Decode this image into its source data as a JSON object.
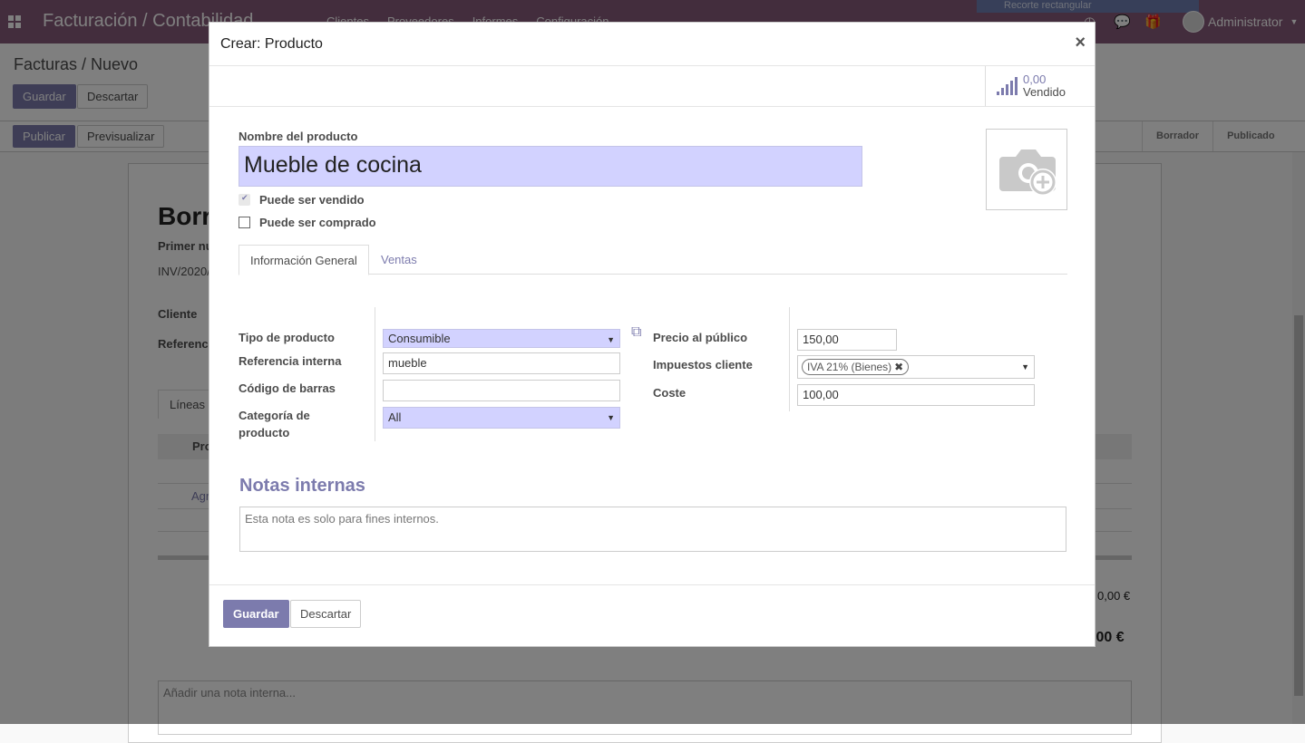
{
  "topbar": {
    "app_title": "Facturación / Contabilidad",
    "menu": [
      "Clientes",
      "Proveedores",
      "Informes",
      "Configuración"
    ],
    "recorder_label": "Recorte rectangular",
    "user_name": "Administrator"
  },
  "control_panel": {
    "breadcrumb": "Facturas / Nuevo",
    "save_label": "Guardar",
    "discard_label": "Descartar",
    "publish_label": "Publicar",
    "preview_label": "Previsualizar",
    "stages": [
      "Borrador",
      "Publicado"
    ]
  },
  "background_sheet": {
    "title": "Borr",
    "first_number_label": "Primer nu",
    "number_value": "INV/2020/",
    "client_label": "Cliente",
    "reference_label": "Referenc",
    "lines_tab": "Líneas",
    "col_product": "Pro",
    "add_line": "Agr",
    "subtotal": "0,00 €",
    "total": ",00 €",
    "note_placeholder": "Añadir una nota interna..."
  },
  "dialog": {
    "title": "Crear: Producto",
    "close_icon": "×",
    "smart_button": {
      "value": "0,00",
      "label": "Vendido"
    },
    "product_name_label": "Nombre del producto",
    "product_name_value": "Mueble de cocina",
    "can_be_sold_label": "Puede ser vendido",
    "can_be_sold": true,
    "can_be_purchased_label": "Puede ser comprado",
    "can_be_purchased": false,
    "tabs": [
      "Información General",
      "Ventas"
    ],
    "left_fields": {
      "product_type_label": "Tipo de producto",
      "product_type_value": "Consumible",
      "internal_ref_label": "Referencia interna",
      "internal_ref_value": "mueble",
      "barcode_label": "Código de barras",
      "barcode_value": "",
      "category_label_1": "Categoría de",
      "category_label_2": "producto",
      "category_value": "All"
    },
    "right_fields": {
      "sale_price_label": "Precio al público",
      "sale_price_value": "150,00",
      "customer_taxes_label": "Impuestos cliente",
      "customer_tax_tag": "IVA 21% (Bienes)",
      "cost_label": "Coste",
      "cost_value": "100,00"
    },
    "notes_title": "Notas internas",
    "notes_placeholder": "Esta nota es solo para fines internos.",
    "footer": {
      "save_label": "Guardar",
      "discard_label": "Descartar"
    }
  },
  "colors": {
    "brand": "#875a7b",
    "primary": "#7c7bad",
    "required_field": "#d2d2ff"
  }
}
